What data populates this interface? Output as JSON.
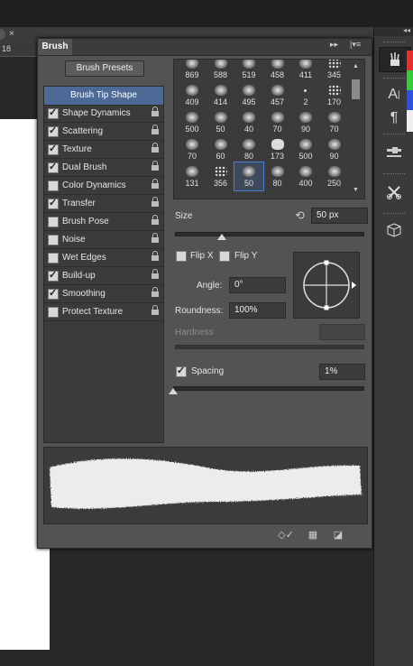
{
  "document": {
    "tab_number": "18",
    "close_glyph": "×"
  },
  "panel": {
    "title": "Brush",
    "presets_button": "Brush Presets",
    "options": [
      {
        "label": "Brush Tip Shape",
        "checkable": false,
        "checked": false,
        "selected": true
      },
      {
        "label": "Shape Dynamics",
        "checkable": true,
        "checked": true
      },
      {
        "label": "Scattering",
        "checkable": true,
        "checked": true
      },
      {
        "label": "Texture",
        "checkable": true,
        "checked": true
      },
      {
        "label": "Dual Brush",
        "checkable": true,
        "checked": true
      },
      {
        "label": "Color Dynamics",
        "checkable": true,
        "checked": false
      },
      {
        "label": "Transfer",
        "checkable": true,
        "checked": true
      },
      {
        "label": "Brush Pose",
        "checkable": true,
        "checked": false
      },
      {
        "label": "Noise",
        "checkable": true,
        "checked": false
      },
      {
        "label": "Wet Edges",
        "checkable": true,
        "checked": false
      },
      {
        "label": "Build-up",
        "checkable": true,
        "checked": true
      },
      {
        "label": "Smoothing",
        "checkable": true,
        "checked": true
      },
      {
        "label": "Protect Texture",
        "checkable": true,
        "checked": false
      }
    ],
    "brush_sizes": [
      [
        "869",
        "588",
        "519",
        "458",
        "411",
        "345"
      ],
      [
        "409",
        "414",
        "495",
        "457",
        "2",
        "170"
      ],
      [
        "500",
        "50",
        "40",
        "70",
        "90",
        "70"
      ],
      [
        "70",
        "60",
        "80",
        "173",
        "500",
        "90"
      ],
      [
        "131",
        "356",
        "50",
        "80",
        "400",
        "250"
      ]
    ],
    "selected_brush": {
      "row": 4,
      "col": 2
    },
    "size": {
      "label": "Size",
      "value": "50 px",
      "slider_fraction": 0.25
    },
    "flip_x": {
      "label": "Flip X",
      "checked": false
    },
    "flip_y": {
      "label": "Flip Y",
      "checked": false
    },
    "angle": {
      "label": "Angle:",
      "value": "0°"
    },
    "roundness": {
      "label": "Roundness:",
      "value": "100%"
    },
    "hardness": {
      "label": "Hardness",
      "value": ""
    },
    "spacing": {
      "label": "Spacing",
      "checked": true,
      "value": "1%",
      "slider_fraction": 0.0
    }
  },
  "colors": {
    "selected_item": "#4d6a96",
    "selected_brush_outline": "#4a7fd6",
    "swatches": [
      "#e53030",
      "#3cc83c",
      "#3050e0",
      "#f0f0f0"
    ]
  }
}
